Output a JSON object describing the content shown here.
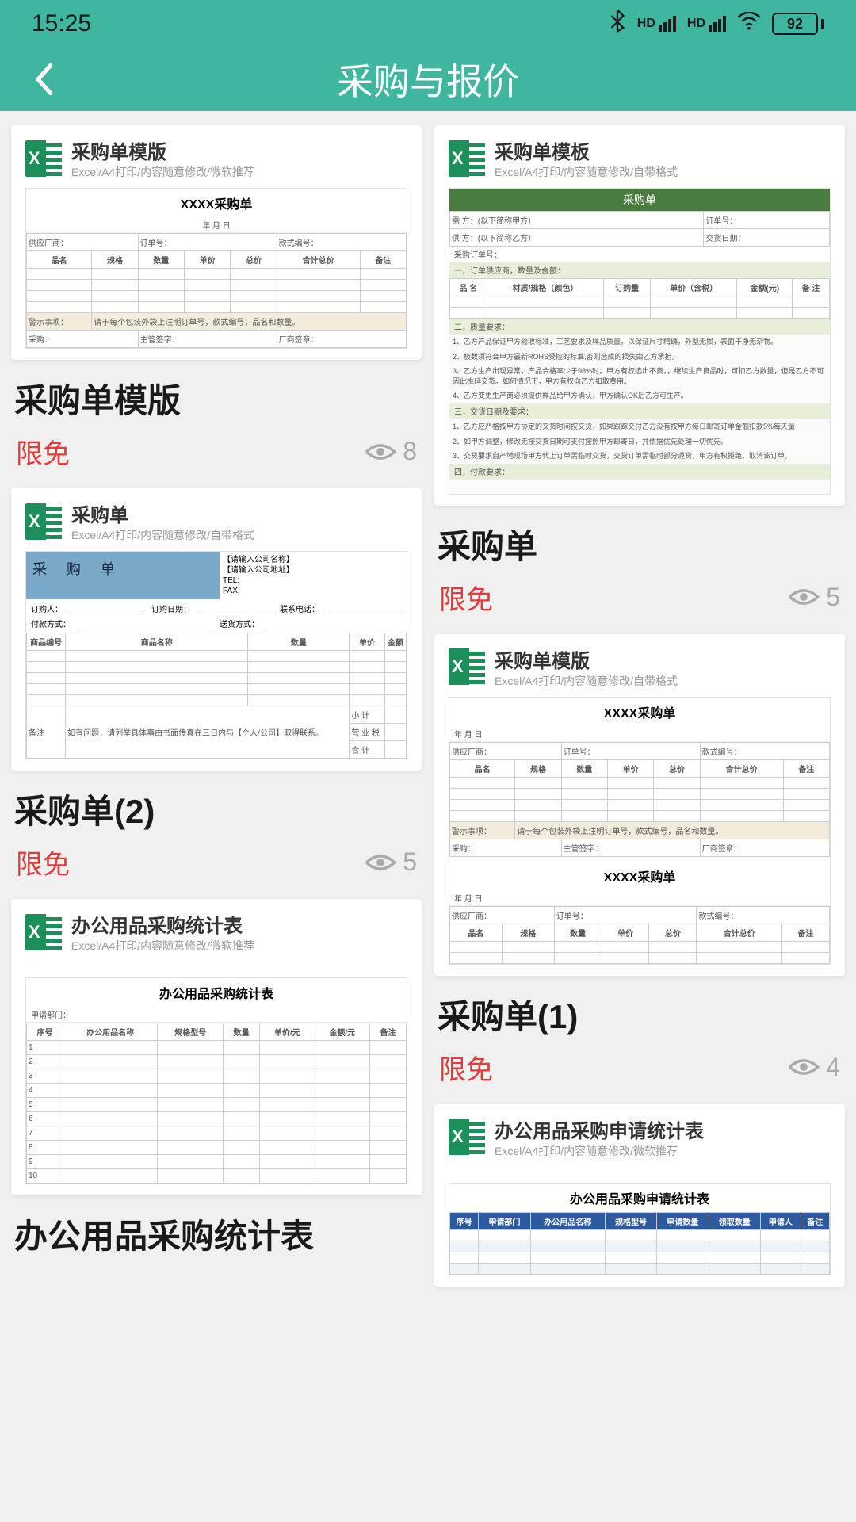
{
  "status": {
    "time": "15:25",
    "hd": "HD",
    "battery": "92"
  },
  "header": {
    "title": "采购与报价"
  },
  "leftColumn": [
    {
      "thumbTitle": "采购单模版",
      "thumbSub": "Excel/A4打印/内容随意修改/微软推荐",
      "cardTitle": "采购单模版",
      "badge": "限免",
      "views": "8",
      "docTitle": "XXXX采购单",
      "headers": [
        "品名",
        "规格",
        "数量",
        "单价",
        "总价",
        "合计总价",
        "备注"
      ],
      "noteLabel": "警示事项：",
      "note": "请于每个包装外袋上注明订单号，款式编号，品名和数量。",
      "dateLabel": "年 月 日",
      "supplierLabel": "供应厂商：",
      "orderNoLabel": "订单号：",
      "styleNoLabel": "款式编号：",
      "purchaserLabel": "采购：",
      "managerLabel": "主管签字：",
      "factoryLabel": "厂商签章："
    },
    {
      "thumbTitle": "采购单",
      "thumbSub": "Excel/A4打印/内容随意修改/自带格式",
      "cardTitle": "采购单(2)",
      "badge": "限免",
      "views": "5",
      "docTitle": "采 购 单",
      "infoLines": [
        "【请输入公司名称】",
        "【请输入公司地址】",
        "TEL:",
        "FAX:"
      ],
      "fieldLabels": {
        "orderer": "订购人：",
        "payMethod": "付款方式：",
        "orderDate": "订购日期：",
        "shipMethod": "送货方式：",
        "contactPhone": "联系电话："
      },
      "headers": [
        "商品编号",
        "商品名称",
        "数量",
        "单价",
        "金额"
      ],
      "footerNote": "如有问题，请列举具体事由书面传真在三日内与【个人/公司】取得联系。",
      "remarkLabel": "备注",
      "totals": [
        "小 计",
        "营 业 税",
        "合 计"
      ]
    },
    {
      "thumbTitle": "办公用品采购统计表",
      "thumbSub": "Excel/A4打印/内容随意修改/微软推荐",
      "cardTitle": "办公用品采购统计表",
      "docTitle": "办公用品采购统计表",
      "headers": [
        "序号",
        "办公用品名称",
        "规格型号",
        "数量",
        "单价/元",
        "金额/元",
        "备注"
      ],
      "deptLabel": "申请部门："
    }
  ],
  "rightColumn": [
    {
      "thumbTitle": "采购单模板",
      "thumbSub": "Excel/A4打印/内容随意修改/自带格式",
      "cardTitle": "采购单",
      "badge": "限免",
      "views": "5",
      "docTitle": "采购单",
      "topRows": [
        [
          "需 方：(以下简称甲方）",
          "订单号："
        ],
        [
          "供 方：(以下简称乙方）",
          "交货日期："
        ]
      ],
      "orderLabel": "采购订单号：",
      "section1": "一，订单供应商，数量及金额：",
      "headers": [
        "品 名",
        "材质/规格（颜色）",
        "订购量",
        "单价（含税）",
        "金额(元)",
        "备 注"
      ],
      "section2": "二，质量要求：",
      "reqs": [
        "1、乙方产品保证甲方验收标准，工艺要求及样品质量，以保证尺寸精确，外型无损，表面干净无杂物。",
        "2、极数须符合甲方最新ROHS受控的标准,否则造成的损失由乙方承担。",
        "3、乙方生产出现异常，产品合格率少于98%时，甲方有权选出不良，，继续生产良品时，可扣乙方数量，但是乙方不可因此推延交货。如何情况下，甲方有权向乙方扣取费用。",
        "4、乙方变更生产商必须提供样品给甲方确认，甲方确认OK后乙方可生产。"
      ],
      "section3": "三，交货日期及要求：",
      "delivery": [
        "1、乙方应严格按甲方协定的交货时间按交货，如果跟踪交付乙方没有按甲方每日邮寄订单金额扣款5%每天量",
        "2、如甲方调整，修改无按交货日期可支付按照甲方邮寄日，并依据优先处理一切优先。",
        "3、交货要求自产地现场甲方代上订单需临时交货，交货订单需临时部分退货，甲方有权拒绝，取消该订单。"
      ],
      "section4": "四，付款要求："
    },
    {
      "thumbTitle": "采购单模版",
      "thumbSub": "Excel/A4打印/内容随意修改/自带格式",
      "cardTitle": "采购单(1)",
      "badge": "限免",
      "views": "4",
      "docTitle": "XXXX采购单",
      "headers": [
        "品名",
        "规格",
        "数量",
        "单价",
        "总价",
        "合计总价",
        "备注"
      ],
      "noteLabel": "警示事项：",
      "note": "请于每个包装外袋上注明订单号，款式编号，品名和数量。",
      "sigLabels": [
        "采购：",
        "主管签字：",
        "厂商签章："
      ],
      "docTitle2": "XXXX采购单",
      "dateLabel": "年 月 日",
      "supplierLabel": "供应厂商：",
      "orderNoLabel": "订单号：",
      "styleNoLabel": "款式编号："
    },
    {
      "thumbTitle": "办公用品采购申请统计表",
      "thumbSub": "Excel/A4打印/内容随意修改/微软推荐",
      "docTitle": "办公用品采购申请统计表",
      "headers": [
        "序号",
        "申请部门",
        "办公用品名称",
        "规格型号",
        "申请数量",
        "领取数量",
        "申请人",
        "备注"
      ]
    }
  ]
}
